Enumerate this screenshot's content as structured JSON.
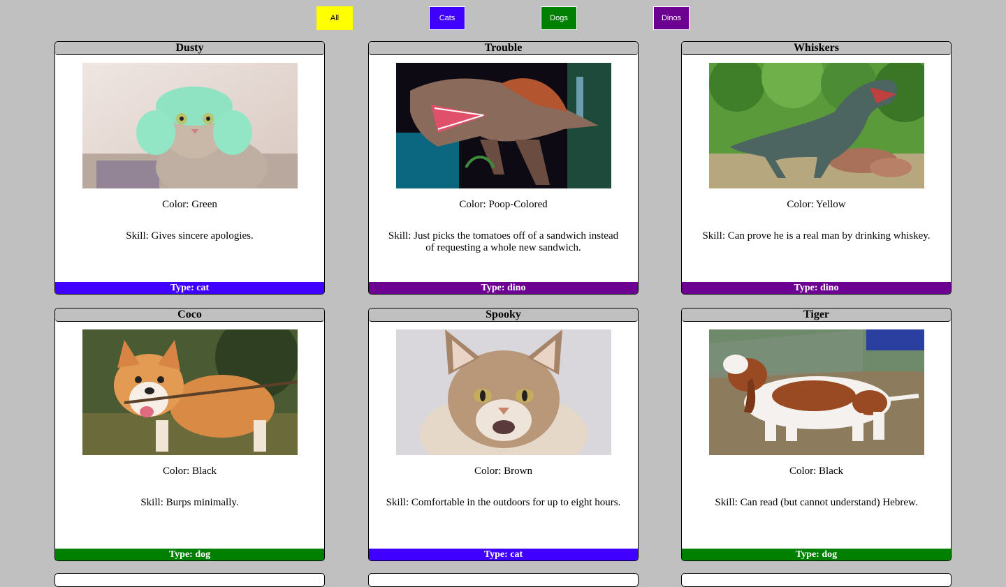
{
  "filters": {
    "all": "All",
    "cats": "Cats",
    "dogs": "Dogs",
    "dinos": "Dinos"
  },
  "colors": {
    "all": "#ffff00",
    "cat": "#4000ff",
    "dog": "#008000",
    "dino": "#6c0090",
    "background": "#c0c0c0"
  },
  "cards": [
    {
      "name": "Dusty",
      "color": "Color: Green",
      "skill": "Skill: Gives sincere apologies.",
      "type": "Type: cat",
      "image": "cat-in-green-hat-photo"
    },
    {
      "name": "Trouble",
      "color": "Color: Poop-Colored",
      "skill": "Skill: Just picks the tomatoes off of a sandwich instead of requesting a whole new sandwich.",
      "type": "Type: dino",
      "image": "spinosaurus-model-photo"
    },
    {
      "name": "Whiskers",
      "color": "Color: Yellow",
      "skill": "Skill: Can prove he is a real man by drinking whiskey.",
      "type": "Type: dino",
      "image": "t-rex-statue-in-forest-photo"
    },
    {
      "name": "Coco",
      "color": "Color: Black",
      "skill": "Skill: Burps minimally.",
      "type": "Type: dog",
      "image": "corgi-with-stick-photo"
    },
    {
      "name": "Spooky",
      "color": "Color: Brown",
      "skill": "Skill: Comfortable in the outdoors for up to eight hours.",
      "type": "Type: cat",
      "image": "maine-coon-cat-photo"
    },
    {
      "name": "Tiger",
      "color": "Color: Black",
      "skill": "Skill: Can read (but cannot understand) Hebrew.",
      "type": "Type: dog",
      "image": "basset-hound-photo"
    }
  ]
}
